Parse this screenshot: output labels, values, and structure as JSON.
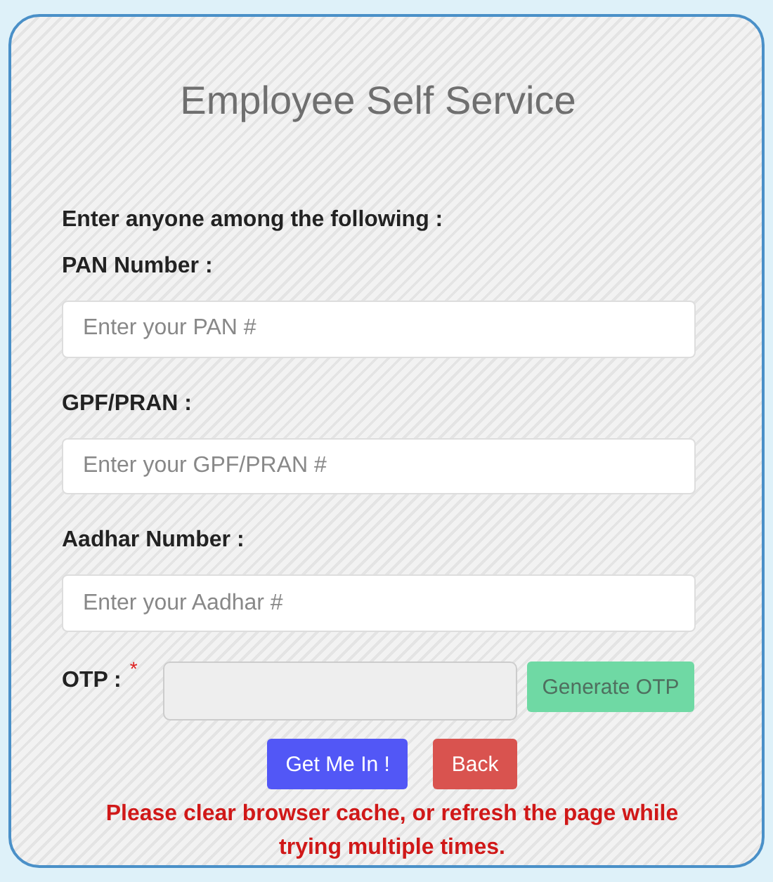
{
  "title": "Employee Self Service",
  "intro": "Enter anyone among the following :",
  "fields": [
    {
      "label": "PAN Number :",
      "placeholder": "Enter your PAN #"
    },
    {
      "label": "GPF/PRAN :",
      "placeholder": "Enter your GPF/PRAN #"
    },
    {
      "label": "Aadhar Number :",
      "placeholder": "Enter your Aadhar #"
    }
  ],
  "otp": {
    "label": "OTP :",
    "required_mark": "*",
    "disabled": true,
    "button": {
      "label": "Generate OTP",
      "disabled": true
    }
  },
  "buttons": [
    {
      "label": "Get Me In !",
      "kind": "primary"
    },
    {
      "label": "Back",
      "kind": "danger"
    }
  ],
  "notice": "Please clear browser cache, or refresh the page while trying multiple times."
}
